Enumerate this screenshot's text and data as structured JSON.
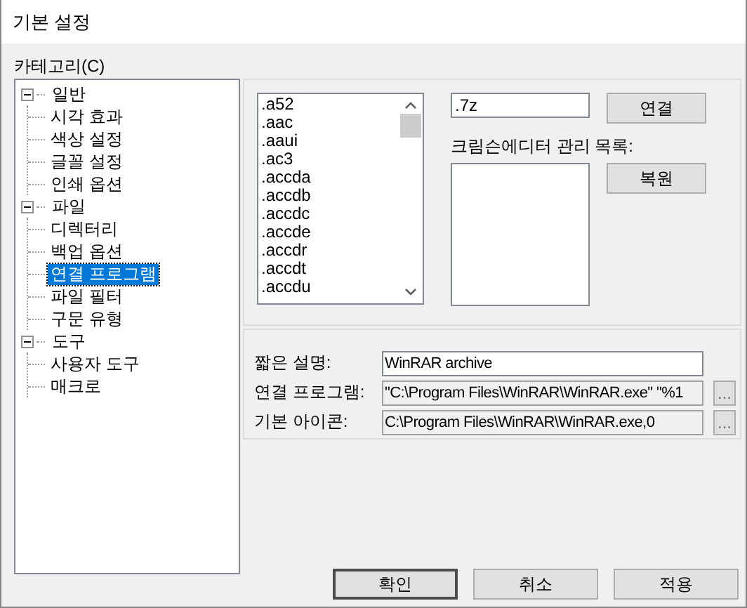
{
  "window": {
    "title": "기본 설정"
  },
  "category_label": "카테고리(C)",
  "tree": [
    {
      "label": "일반",
      "expanded": true,
      "selected": false,
      "children": [
        {
          "label": "시각 효과",
          "selected": false
        },
        {
          "label": "색상 설정",
          "selected": false
        },
        {
          "label": "글꼴 설정",
          "selected": false
        },
        {
          "label": "인쇄 옵션",
          "selected": false
        }
      ]
    },
    {
      "label": "파일",
      "expanded": true,
      "selected": false,
      "children": [
        {
          "label": "디렉터리",
          "selected": false
        },
        {
          "label": "백업 옵션",
          "selected": false
        },
        {
          "label": "연결 프로그램",
          "selected": true
        },
        {
          "label": "파일 필터",
          "selected": false
        },
        {
          "label": "구문 유형",
          "selected": false
        }
      ]
    },
    {
      "label": "도구",
      "expanded": true,
      "selected": false,
      "children": [
        {
          "label": "사용자 도구",
          "selected": false
        },
        {
          "label": "매크로",
          "selected": false
        }
      ]
    }
  ],
  "extensions": [
    ".a52",
    ".aac",
    ".aaui",
    ".ac3",
    ".accda",
    ".accdb",
    ".accdc",
    ".accde",
    ".accdr",
    ".accdt",
    ".accdu"
  ],
  "extension_field": {
    "value": ".7z"
  },
  "associate_button": "연결",
  "managed_label": "크림슨에디터 관리 목록:",
  "restore_button": "복원",
  "details": [
    {
      "label": "짧은 설명:",
      "value": "WinRAR archive",
      "disabled": false
    },
    {
      "label": "연결 프로그램:",
      "value": "\"C:\\Program Files\\WinRAR\\WinRAR.exe\" \"%1",
      "disabled": true,
      "browse": "..."
    },
    {
      "label": "기본 아이콘:",
      "value": "C:\\Program Files\\WinRAR\\WinRAR.exe,0",
      "disabled": true,
      "browse": "..."
    }
  ],
  "buttons": [
    {
      "label": "확인",
      "default": true
    },
    {
      "label": "취소",
      "default": false
    },
    {
      "label": "적용",
      "default": false
    }
  ]
}
